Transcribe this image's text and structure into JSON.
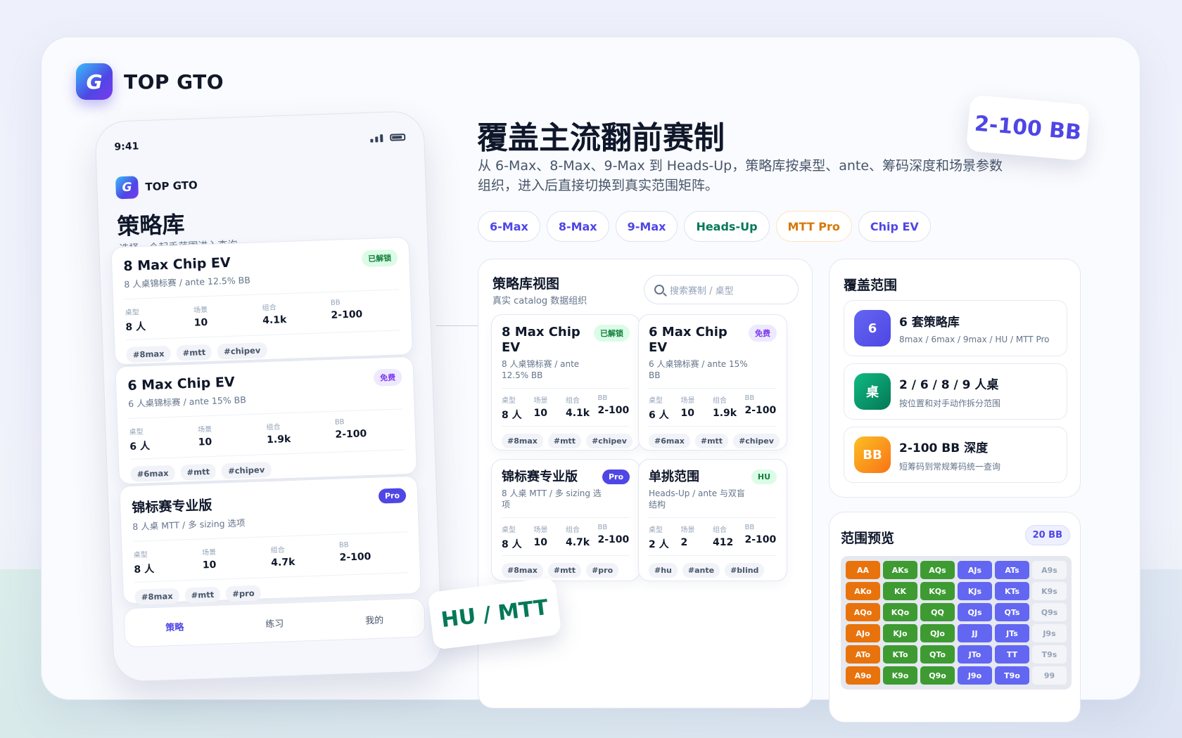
{
  "brand": {
    "logo_letter": "G",
    "name": "TOP GTO"
  },
  "phone": {
    "time": "9:41",
    "brand_name": "TOP GTO",
    "title": "策略库",
    "subtitle": "选择一个起手范围进入查询",
    "cards": [
      {
        "title": "8 Max Chip EV",
        "subtitle": "8 人桌锦标赛 / ante 12.5% BB",
        "badge": "已解锁",
        "stats": [
          {
            "k": "桌型",
            "v": "8 人"
          },
          {
            "k": "场景",
            "v": "10"
          },
          {
            "k": "组合",
            "v": "4.1k"
          },
          {
            "k": "BB",
            "v": "2-100"
          }
        ],
        "tags": [
          "#8max",
          "#mtt",
          "#chipev"
        ]
      },
      {
        "title": "6 Max Chip EV",
        "subtitle": "6 人桌锦标赛 / ante 15% BB",
        "badge": "免费",
        "stats": [
          {
            "k": "桌型",
            "v": "6 人"
          },
          {
            "k": "场景",
            "v": "10"
          },
          {
            "k": "组合",
            "v": "1.9k"
          },
          {
            "k": "BB",
            "v": "2-100"
          }
        ],
        "tags": [
          "#6max",
          "#mtt",
          "#chipev"
        ]
      },
      {
        "title": "锦标赛专业版",
        "subtitle": "8 人桌 MTT / 多 sizing 选项",
        "badge": "Pro",
        "stats": [
          {
            "k": "桌型",
            "v": "8 人"
          },
          {
            "k": "场景",
            "v": "10"
          },
          {
            "k": "组合",
            "v": "4.7k"
          },
          {
            "k": "BB",
            "v": "2-100"
          }
        ],
        "tags": [
          "#8max",
          "#mtt",
          "#pro"
        ]
      }
    ],
    "nav": [
      "策略",
      "练习",
      "我的"
    ]
  },
  "sticker_hu": "HU / MTT",
  "sticker_bb": "2-100 BB",
  "hero": {
    "title": "覆盖主流翻前赛制",
    "desc": "从 6-Max、8-Max、9-Max 到 Heads-Up，策略库按桌型、ante、筹码深度和场景参数组织，进入后直接切换到真实范围矩阵。",
    "chips": [
      "6-Max",
      "8-Max",
      "9-Max",
      "Heads-Up",
      "MTT Pro",
      "Chip EV"
    ]
  },
  "library": {
    "title": "策略库视图",
    "subtitle": "真实 catalog 数据组织",
    "search_placeholder": "搜索赛制 / 桌型",
    "cards": [
      {
        "title": "8 Max Chip EV",
        "subtitle": "8 人桌锦标赛 / ante 12.5% BB",
        "badge": "已解锁",
        "stats": [
          {
            "k": "桌型",
            "v": "8 人"
          },
          {
            "k": "场景",
            "v": "10"
          },
          {
            "k": "组合",
            "v": "4.1k"
          },
          {
            "k": "BB",
            "v": "2-100"
          }
        ],
        "tags": [
          "#8max",
          "#mtt",
          "#chipev"
        ]
      },
      {
        "title": "6 Max Chip EV",
        "subtitle": "6 人桌锦标赛 / ante 15% BB",
        "badge": "免费",
        "stats": [
          {
            "k": "桌型",
            "v": "6 人"
          },
          {
            "k": "场景",
            "v": "10"
          },
          {
            "k": "组合",
            "v": "1.9k"
          },
          {
            "k": "BB",
            "v": "2-100"
          }
        ],
        "tags": [
          "#6max",
          "#mtt",
          "#chipev"
        ]
      },
      {
        "title": "锦标赛专业版",
        "subtitle": "8 人桌 MTT / 多 sizing 选项",
        "badge": "Pro",
        "stats": [
          {
            "k": "桌型",
            "v": "8 人"
          },
          {
            "k": "场景",
            "v": "10"
          },
          {
            "k": "组合",
            "v": "4.7k"
          },
          {
            "k": "BB",
            "v": "2-100"
          }
        ],
        "tags": [
          "#8max",
          "#mtt",
          "#pro"
        ]
      },
      {
        "title": "单挑范围",
        "subtitle": "Heads-Up / ante 与双盲结构",
        "badge": "HU",
        "stats": [
          {
            "k": "桌型",
            "v": "2 人"
          },
          {
            "k": "场景",
            "v": "2"
          },
          {
            "k": "组合",
            "v": "412"
          },
          {
            "k": "BB",
            "v": "2-100"
          }
        ],
        "tags": [
          "#hu",
          "#ante",
          "#blind"
        ]
      }
    ]
  },
  "coverage": {
    "title": "覆盖范围",
    "items": [
      {
        "icon": "6",
        "main": "6 套策略库",
        "sub": "8max / 6max / 9max / HU / MTT Pro"
      },
      {
        "icon": "桌",
        "main": "2 / 6 / 8 / 9 人桌",
        "sub": "按位置和对手动作拆分范围"
      },
      {
        "icon": "BB",
        "main": "2-100 BB 深度",
        "sub": "短筹码到常规筹码统一查询"
      }
    ]
  },
  "range": {
    "title": "范围预览",
    "badge": "20 BB",
    "colors": {
      "raise": "#e8730c",
      "call": "#3d9b32",
      "shove": "#6366f1",
      "fold": "#f3f4f7"
    },
    "rows": [
      [
        {
          "h": "AA",
          "a": "raise"
        },
        {
          "h": "AKs",
          "a": "call"
        },
        {
          "h": "AQs",
          "a": "call"
        },
        {
          "h": "AJs",
          "a": "shove"
        },
        {
          "h": "ATs",
          "a": "shove"
        },
        {
          "h": "A9s",
          "a": "fold"
        }
      ],
      [
        {
          "h": "AKo",
          "a": "raise"
        },
        {
          "h": "KK",
          "a": "call"
        },
        {
          "h": "KQs",
          "a": "call"
        },
        {
          "h": "KJs",
          "a": "shove"
        },
        {
          "h": "KTs",
          "a": "shove"
        },
        {
          "h": "K9s",
          "a": "fold"
        }
      ],
      [
        {
          "h": "AQo",
          "a": "raise"
        },
        {
          "h": "KQo",
          "a": "call"
        },
        {
          "h": "QQ",
          "a": "call"
        },
        {
          "h": "QJs",
          "a": "shove"
        },
        {
          "h": "QTs",
          "a": "shove"
        },
        {
          "h": "Q9s",
          "a": "fold"
        }
      ],
      [
        {
          "h": "AJo",
          "a": "raise"
        },
        {
          "h": "KJo",
          "a": "call"
        },
        {
          "h": "QJo",
          "a": "call"
        },
        {
          "h": "JJ",
          "a": "shove"
        },
        {
          "h": "JTs",
          "a": "shove"
        },
        {
          "h": "J9s",
          "a": "fold"
        }
      ],
      [
        {
          "h": "ATo",
          "a": "raise"
        },
        {
          "h": "KTo",
          "a": "call"
        },
        {
          "h": "QTo",
          "a": "call"
        },
        {
          "h": "JTo",
          "a": "shove"
        },
        {
          "h": "TT",
          "a": "shove"
        },
        {
          "h": "T9s",
          "a": "fold"
        }
      ],
      [
        {
          "h": "A9o",
          "a": "raise"
        },
        {
          "h": "K9o",
          "a": "call"
        },
        {
          "h": "Q9o",
          "a": "call"
        },
        {
          "h": "J9o",
          "a": "shove"
        },
        {
          "h": "T9o",
          "a": "shove"
        },
        {
          "h": "99",
          "a": "fold"
        }
      ]
    ]
  }
}
